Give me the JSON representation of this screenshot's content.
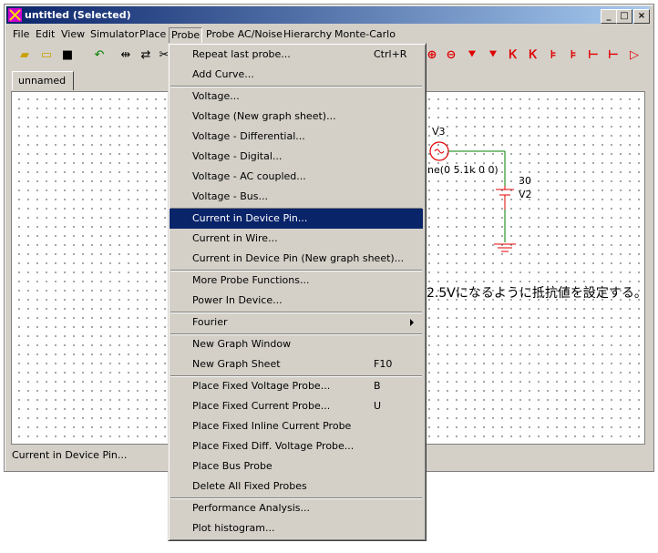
{
  "window": {
    "title": "untitled (Selected)"
  },
  "menubar": [
    {
      "label": "File"
    },
    {
      "label": "Edit"
    },
    {
      "label": "View"
    },
    {
      "label": "Simulator"
    },
    {
      "label": "Place"
    },
    {
      "label": "Probe"
    },
    {
      "label": "Probe AC/Noise"
    },
    {
      "label": "Hierarchy"
    },
    {
      "label": "Monte-Carlo"
    }
  ],
  "tab": {
    "label": "unnamed"
  },
  "status": {
    "text": "Current in Device Pin..."
  },
  "schematic": {
    "v3_label": "V3",
    "v3_value": "ine(0 5.1k 0 0)",
    "v2_num": "30",
    "v2_label": "V2",
    "note": "2.5Vになるように抵抗値を設定する。"
  },
  "probe_menu": {
    "items": [
      {
        "label": "Repeat last probe...",
        "shortcut": "Ctrl+R"
      },
      {
        "label": "Add Curve...",
        "shortcut": ""
      },
      {
        "label": "Voltage...",
        "shortcut": ""
      },
      {
        "label": "Voltage (New graph sheet)...",
        "shortcut": ""
      },
      {
        "label": "Voltage - Differential...",
        "shortcut": ""
      },
      {
        "label": "Voltage - Digital...",
        "shortcut": ""
      },
      {
        "label": "Voltage - AC coupled...",
        "shortcut": ""
      },
      {
        "label": "Voltage - Bus...",
        "shortcut": ""
      },
      {
        "label": "Current in Device Pin...",
        "shortcut": ""
      },
      {
        "label": "Current in Wire...",
        "shortcut": ""
      },
      {
        "label": "Current in Device Pin (New graph sheet)...",
        "shortcut": ""
      },
      {
        "label": "More Probe Functions...",
        "shortcut": ""
      },
      {
        "label": "Power In Device...",
        "shortcut": ""
      },
      {
        "label": "Fourier",
        "shortcut": ""
      },
      {
        "label": "New Graph Window",
        "shortcut": ""
      },
      {
        "label": "New Graph Sheet",
        "shortcut": "F10"
      },
      {
        "label": "Place Fixed Voltage Probe...",
        "shortcut": "B"
      },
      {
        "label": "Place Fixed Current Probe...",
        "shortcut": "U"
      },
      {
        "label": "Place Fixed Inline Current Probe",
        "shortcut": ""
      },
      {
        "label": "Place Fixed Diff. Voltage Probe...",
        "shortcut": ""
      },
      {
        "label": "Place Bus Probe",
        "shortcut": ""
      },
      {
        "label": "Delete All Fixed Probes",
        "shortcut": ""
      },
      {
        "label": "Performance Analysis...",
        "shortcut": ""
      },
      {
        "label": "Plot histogram...",
        "shortcut": ""
      }
    ]
  },
  "colors": {
    "selection": "#0a246a",
    "titlebar": "#0a246a",
    "accent_red": "#e00000",
    "wire_green": "#008000"
  }
}
